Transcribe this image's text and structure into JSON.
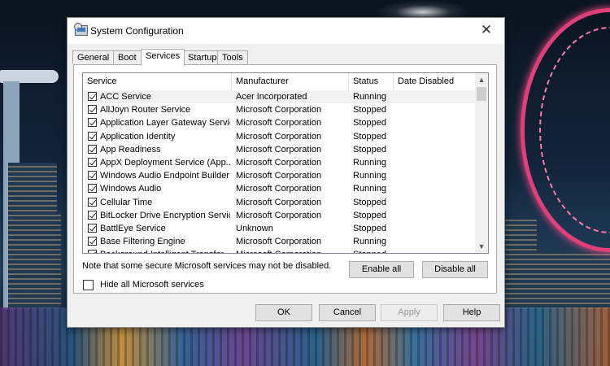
{
  "window": {
    "title": "System Configuration",
    "close_glyph": "✕"
  },
  "tabs": [
    {
      "label": "General",
      "active": false
    },
    {
      "label": "Boot",
      "active": false
    },
    {
      "label": "Services",
      "active": true
    },
    {
      "label": "Startup",
      "active": false
    },
    {
      "label": "Tools",
      "active": false
    }
  ],
  "services_list": {
    "columns": [
      "Service",
      "Manufacturer",
      "Status",
      "Date Disabled"
    ],
    "rows": [
      {
        "service": "ACC Service",
        "manufacturer": "Acer Incorporated",
        "status": "Running",
        "date_disabled": "",
        "checked": true
      },
      {
        "service": "AllJoyn Router Service",
        "manufacturer": "Microsoft Corporation",
        "status": "Stopped",
        "date_disabled": "",
        "checked": true
      },
      {
        "service": "Application Layer Gateway Service",
        "manufacturer": "Microsoft Corporation",
        "status": "Stopped",
        "date_disabled": "",
        "checked": true
      },
      {
        "service": "Application Identity",
        "manufacturer": "Microsoft Corporation",
        "status": "Stopped",
        "date_disabled": "",
        "checked": true
      },
      {
        "service": "App Readiness",
        "manufacturer": "Microsoft Corporation",
        "status": "Stopped",
        "date_disabled": "",
        "checked": true
      },
      {
        "service": "AppX Deployment Service (App...",
        "manufacturer": "Microsoft Corporation",
        "status": "Running",
        "date_disabled": "",
        "checked": true
      },
      {
        "service": "Windows Audio Endpoint Builder",
        "manufacturer": "Microsoft Corporation",
        "status": "Running",
        "date_disabled": "",
        "checked": true
      },
      {
        "service": "Windows Audio",
        "manufacturer": "Microsoft Corporation",
        "status": "Running",
        "date_disabled": "",
        "checked": true
      },
      {
        "service": "Cellular Time",
        "manufacturer": "Microsoft Corporation",
        "status": "Stopped",
        "date_disabled": "",
        "checked": true
      },
      {
        "service": "BitLocker Drive Encryption Service",
        "manufacturer": "Microsoft Corporation",
        "status": "Stopped",
        "date_disabled": "",
        "checked": true
      },
      {
        "service": "BattlEye Service",
        "manufacturer": "Unknown",
        "status": "Stopped",
        "date_disabled": "",
        "checked": true
      },
      {
        "service": "Base Filtering Engine",
        "manufacturer": "Microsoft Corporation",
        "status": "Running",
        "date_disabled": "",
        "checked": true
      },
      {
        "service": "Background Intelligent Transfer ...",
        "manufacturer": "Microsoft Corporation",
        "status": "Stopped",
        "date_disabled": "",
        "checked": true
      }
    ]
  },
  "note": "Note that some secure Microsoft services may not be disabled.",
  "buttons": {
    "enable_all": "Enable all",
    "disable_all": "Disable all",
    "ok": "OK",
    "cancel": "Cancel",
    "apply": "Apply",
    "help": "Help"
  },
  "hide_ms_services": {
    "label": "Hide all Microsoft services",
    "checked": false
  },
  "scrollbar": {
    "up_glyph": "▲",
    "down_glyph": "▼"
  }
}
